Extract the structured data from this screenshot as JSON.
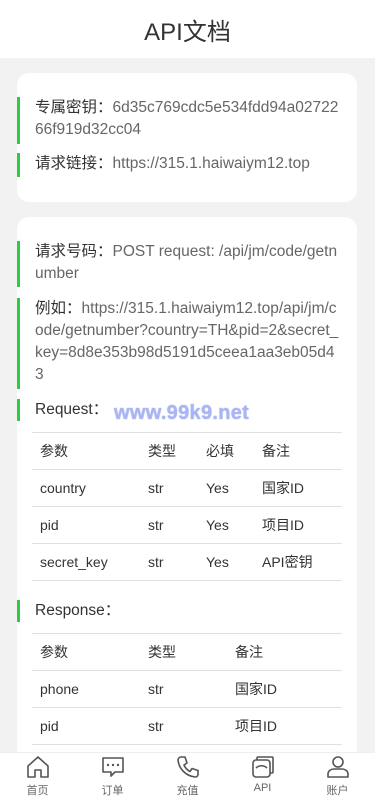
{
  "header": {
    "title": "API文档"
  },
  "info": {
    "key_label": "专属密钥：",
    "key_value": "6d35c769cdc5e534fdd94a0272266f919d32cc04",
    "link_label": "请求链接：",
    "link_value": "https://315.1.haiwaiym12.top"
  },
  "getnumber": {
    "req_label": "请求号码：",
    "req_value": "POST request: /api/jm/code/getnumber",
    "example_label": "例如：",
    "example_value": "https://315.1.haiwaiym12.top/api/jm/code/getnumber?country=TH&pid=2&secret_key=8d8e353b98d5191d5ceea1aa3eb05d43",
    "request_label": "Request：",
    "watermark": "www.99k9.net",
    "request_table": {
      "headers": [
        "参数",
        "类型",
        "必填",
        "备注"
      ],
      "rows": [
        [
          "country",
          "str",
          "Yes",
          "国家ID"
        ],
        [
          "pid",
          "str",
          "Yes",
          "项目ID"
        ],
        [
          "secret_key",
          "str",
          "Yes",
          "API密钥"
        ]
      ]
    },
    "response_label": "Response：",
    "response_table": {
      "headers": [
        "参数",
        "类型",
        "备注"
      ],
      "rows": [
        [
          "phone",
          "str",
          "国家ID"
        ],
        [
          "pid",
          "str",
          "项目ID"
        ]
      ]
    }
  },
  "nav": {
    "items": [
      {
        "label": "首页",
        "icon": "home-icon"
      },
      {
        "label": "订单",
        "icon": "message-icon"
      },
      {
        "label": "充值",
        "icon": "phone-icon"
      },
      {
        "label": "API",
        "icon": "api-icon"
      },
      {
        "label": "账户",
        "icon": "user-icon"
      }
    ]
  }
}
